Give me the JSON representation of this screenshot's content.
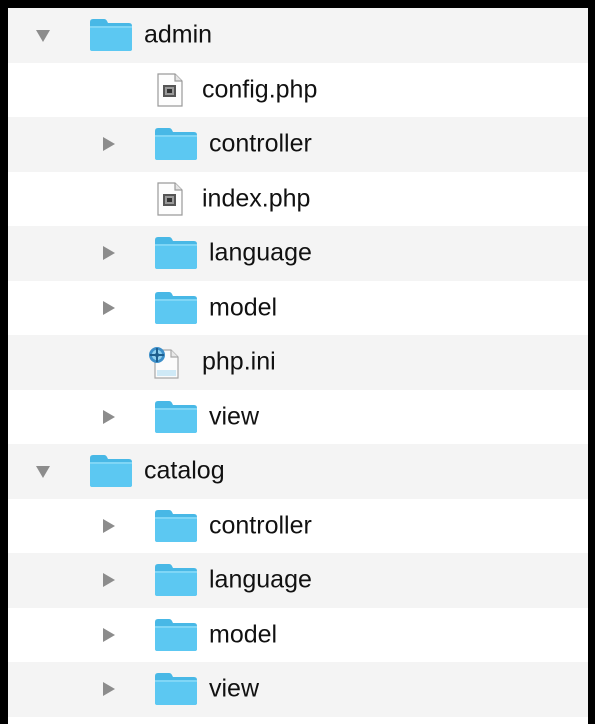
{
  "tree": {
    "rows": [
      {
        "label": "admin",
        "kind": "folder",
        "expanded": true,
        "level": 0
      },
      {
        "label": "config.php",
        "kind": "php-file",
        "level": 1
      },
      {
        "label": "controller",
        "kind": "folder",
        "expanded": false,
        "level": 1
      },
      {
        "label": "index.php",
        "kind": "php-file",
        "level": 1
      },
      {
        "label": "language",
        "kind": "folder",
        "expanded": false,
        "level": 1
      },
      {
        "label": "model",
        "kind": "folder",
        "expanded": false,
        "level": 1
      },
      {
        "label": "php.ini",
        "kind": "ini-file",
        "level": 1
      },
      {
        "label": "view",
        "kind": "folder",
        "expanded": false,
        "level": 1
      },
      {
        "label": "catalog",
        "kind": "folder",
        "expanded": true,
        "level": 0
      },
      {
        "label": "controller",
        "kind": "folder",
        "expanded": false,
        "level": 1
      },
      {
        "label": "language",
        "kind": "folder",
        "expanded": false,
        "level": 1
      },
      {
        "label": "model",
        "kind": "folder",
        "expanded": false,
        "level": 1
      },
      {
        "label": "view",
        "kind": "folder",
        "expanded": false,
        "level": 1
      }
    ]
  },
  "colors": {
    "folder": "#5cc8f2",
    "folder_tab": "#48b8e6",
    "stripe": "#f4f4f4",
    "disclosure": "#8c8c8c",
    "text": "#111111"
  },
  "icons": {
    "folder": "folder-icon",
    "php-file": "php-file-icon",
    "ini-file": "ini-file-icon",
    "expanded": "disclosure-open-icon",
    "collapsed": "disclosure-closed-icon"
  }
}
